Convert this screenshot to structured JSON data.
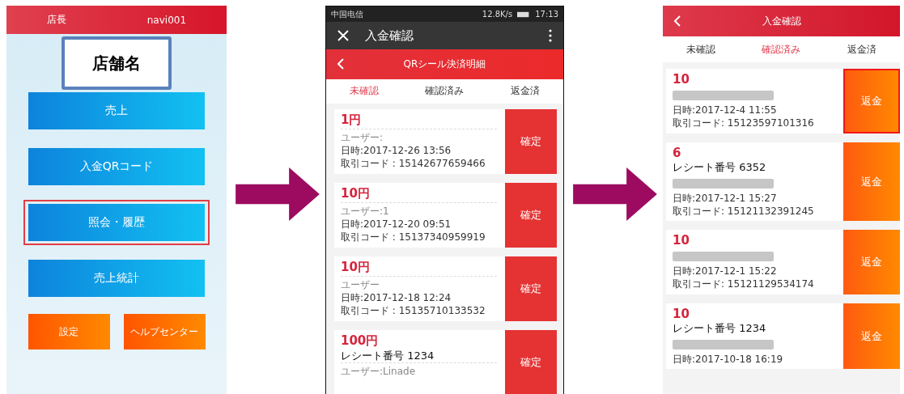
{
  "home_screen": {
    "header_left": "店長",
    "header_right": "navi001",
    "store_name": "店舗名",
    "menu_buttons": [
      {
        "label": "売上",
        "highlighted": false
      },
      {
        "label": "入金QRコード",
        "highlighted": false
      },
      {
        "label": "照会・履歴",
        "highlighted": true
      },
      {
        "label": "売上統計",
        "highlighted": false
      }
    ],
    "bottom_buttons": [
      {
        "label": "設定"
      },
      {
        "label": "ヘルプセンター"
      }
    ]
  },
  "pending_screen": {
    "status_bar": {
      "carrier": "中国电信",
      "speed": "12.8K/s",
      "time": "17:13"
    },
    "title": "入金確認",
    "header_title": "QRシール決済明細",
    "tabs": [
      {
        "label": "未確認",
        "selected": true
      },
      {
        "label": "確認済み",
        "selected": false
      },
      {
        "label": "返金済",
        "selected": false
      }
    ],
    "cards": [
      {
        "amount": "1円",
        "lines": [
          {
            "kind": "user",
            "text": "ユーザー:"
          },
          {
            "kind": "date",
            "text": "日時:2017-12-26 13:56"
          },
          {
            "kind": "code",
            "text": "取引コード : 15142677659466"
          }
        ],
        "button": "確定",
        "highlighted": false
      },
      {
        "amount": "10円",
        "lines": [
          {
            "kind": "user",
            "text": "ユーザー:1"
          },
          {
            "kind": "date",
            "text": "日時:2017-12-20 09:51"
          },
          {
            "kind": "code",
            "text": "取引コード : 15137340959919"
          }
        ],
        "button": "確定",
        "highlighted": false
      },
      {
        "amount": "10円",
        "lines": [
          {
            "kind": "user",
            "text": "ユーザー"
          },
          {
            "kind": "date",
            "text": "日時:2017-12-18 12:24"
          },
          {
            "kind": "code",
            "text": "取引コード : 15135710133532"
          }
        ],
        "button": "確定",
        "highlighted": false
      },
      {
        "amount": "100円",
        "lines": [
          {
            "kind": "receipt",
            "text": "レシート番号 1234"
          },
          {
            "kind": "user",
            "text": "ユーザー:Linade"
          }
        ],
        "button": "確定",
        "highlighted": false
      }
    ]
  },
  "confirmed_screen": {
    "title": "入金確認",
    "tabs": [
      {
        "label": "未確認",
        "selected": false
      },
      {
        "label": "確認済み",
        "selected": true
      },
      {
        "label": "返金済",
        "selected": false
      }
    ],
    "cards": [
      {
        "amount": "10",
        "lines": [
          {
            "kind": "redacted"
          },
          {
            "kind": "date",
            "text": "日時:2017-12-4 11:55"
          },
          {
            "kind": "code",
            "text": "取引コード: 15123597101316"
          }
        ],
        "button": "返金",
        "highlighted": true
      },
      {
        "amount": "6",
        "lines": [
          {
            "kind": "receipt",
            "text": "レシート番号 6352"
          },
          {
            "kind": "redacted"
          },
          {
            "kind": "date",
            "text": "日時:2017-12-1 15:27"
          },
          {
            "kind": "code",
            "text": "取引コード: 15121132391245"
          }
        ],
        "button": "返金",
        "highlighted": false
      },
      {
        "amount": "10",
        "lines": [
          {
            "kind": "redacted"
          },
          {
            "kind": "date",
            "text": "日時:2017-12-1 15:22"
          },
          {
            "kind": "code",
            "text": "取引コード: 15121129534174"
          }
        ],
        "button": "返金",
        "highlighted": false
      },
      {
        "amount": "10",
        "lines": [
          {
            "kind": "receipt",
            "text": "レシート番号 1234"
          },
          {
            "kind": "redacted"
          },
          {
            "kind": "date",
            "text": "日時:2017-10-18 16:19"
          }
        ],
        "button": "返金",
        "highlighted": false
      }
    ]
  }
}
